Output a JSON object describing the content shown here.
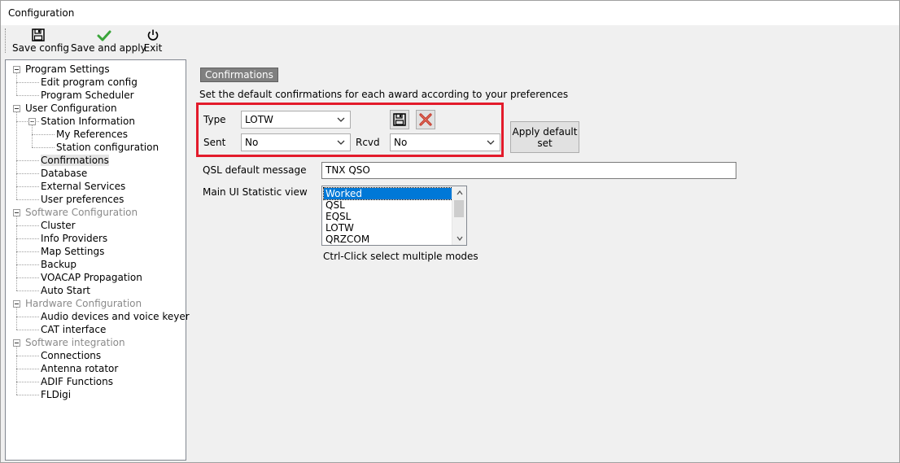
{
  "window": {
    "title": "Configuration"
  },
  "toolbar": {
    "save_config": "Save config",
    "save_and_apply": "Save and apply",
    "exit": "Exit"
  },
  "tree": [
    {
      "label": "Program Settings",
      "level": 0,
      "dim": false,
      "sel": false,
      "expander": true
    },
    {
      "label": "Edit program config",
      "level": 1,
      "dim": false,
      "sel": false,
      "expander": false
    },
    {
      "label": "Program Scheduler",
      "level": 1,
      "dim": false,
      "sel": false,
      "expander": false
    },
    {
      "label": "User Configuration",
      "level": 0,
      "dim": false,
      "sel": false,
      "expander": true
    },
    {
      "label": "Station Information",
      "level": 1,
      "dim": false,
      "sel": false,
      "expander": true
    },
    {
      "label": "My References",
      "level": 2,
      "dim": false,
      "sel": false,
      "expander": false
    },
    {
      "label": "Station configuration",
      "level": 2,
      "dim": false,
      "sel": false,
      "expander": false
    },
    {
      "label": "Confirmations",
      "level": 1,
      "dim": false,
      "sel": true,
      "expander": false
    },
    {
      "label": "Database",
      "level": 1,
      "dim": false,
      "sel": false,
      "expander": false
    },
    {
      "label": "External Services",
      "level": 1,
      "dim": false,
      "sel": false,
      "expander": false
    },
    {
      "label": "User preferences",
      "level": 1,
      "dim": false,
      "sel": false,
      "expander": false
    },
    {
      "label": "Software Configuration",
      "level": 0,
      "dim": true,
      "sel": false,
      "expander": true
    },
    {
      "label": "Cluster",
      "level": 1,
      "dim": false,
      "sel": false,
      "expander": false
    },
    {
      "label": "Info Providers",
      "level": 1,
      "dim": false,
      "sel": false,
      "expander": false
    },
    {
      "label": "Map Settings",
      "level": 1,
      "dim": false,
      "sel": false,
      "expander": false
    },
    {
      "label": "Backup",
      "level": 1,
      "dim": false,
      "sel": false,
      "expander": false
    },
    {
      "label": "VOACAP Propagation",
      "level": 1,
      "dim": false,
      "sel": false,
      "expander": false
    },
    {
      "label": "Auto Start",
      "level": 1,
      "dim": false,
      "sel": false,
      "expander": false
    },
    {
      "label": "Hardware Configuration",
      "level": 0,
      "dim": true,
      "sel": false,
      "expander": true
    },
    {
      "label": "Audio devices and voice keyer",
      "level": 1,
      "dim": false,
      "sel": false,
      "expander": false
    },
    {
      "label": "CAT interface",
      "level": 1,
      "dim": false,
      "sel": false,
      "expander": false
    },
    {
      "label": "Software integration",
      "level": 0,
      "dim": true,
      "sel": false,
      "expander": true
    },
    {
      "label": "Connections",
      "level": 1,
      "dim": false,
      "sel": false,
      "expander": false
    },
    {
      "label": "Antenna rotator",
      "level": 1,
      "dim": false,
      "sel": false,
      "expander": false
    },
    {
      "label": "ADIF Functions",
      "level": 1,
      "dim": false,
      "sel": false,
      "expander": false
    },
    {
      "label": "FLDigi",
      "level": 1,
      "dim": false,
      "sel": false,
      "expander": false
    }
  ],
  "panel": {
    "section": "Confirmations",
    "description": "Set the default confirmations for each award according to your preferences",
    "type_label": "Type",
    "type_value": "LOTW",
    "sent_label": "Sent",
    "sent_value": "No",
    "rcvd_label": "Rcvd",
    "rcvd_value": "No",
    "apply_default": "Apply default set",
    "qsl_label": "QSL default message",
    "qsl_value": "TNX QSO",
    "stat_label": "Main UI Statistic view",
    "stat_items": [
      "Worked",
      "QSL",
      "EQSL",
      "LOTW",
      "QRZCOM"
    ],
    "stat_selected": "Worked",
    "hint": "Ctrl-Click select multiple modes"
  },
  "colors": {
    "highlight": "#e31b2b",
    "selection": "#0078d7"
  }
}
